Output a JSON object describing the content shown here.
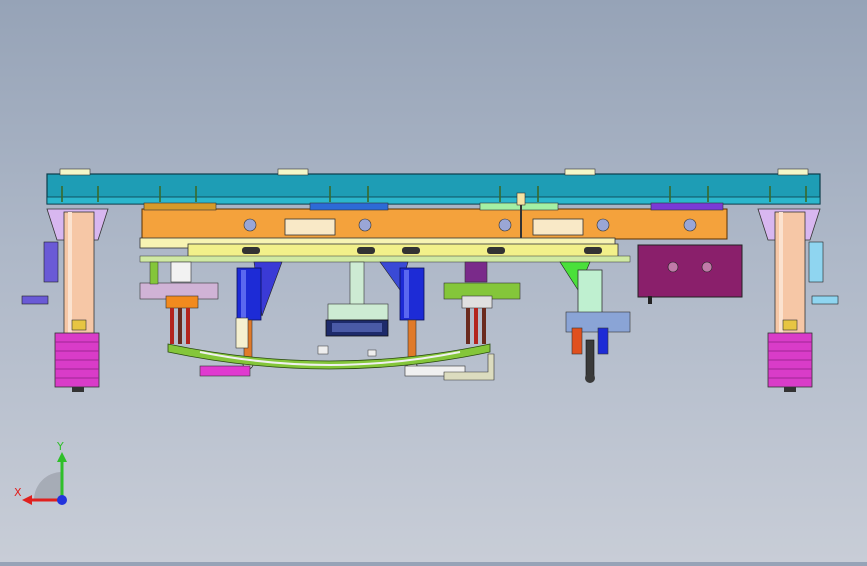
{
  "viewport": {
    "background_top": "#96a3b7",
    "background_bottom": "#c8cdd7"
  },
  "triad": {
    "x_label": "X",
    "y_label": "Y",
    "x_color": "#e0201e",
    "y_color": "#2fbf2a",
    "z_color": "#2233dd"
  },
  "colors": {
    "top_beam": "#1e9db5",
    "orange_frame": "#f4a23c",
    "yellow_bar": "#f2f08a",
    "purple_block": "#8a1f6b",
    "magenta_foot": "#d93cc8",
    "salmon_column": "#f6c7a6",
    "blue_cylinder": "#1d2bd6",
    "green_arm": "#84c63a",
    "cyan_part": "#8fe6f0"
  }
}
